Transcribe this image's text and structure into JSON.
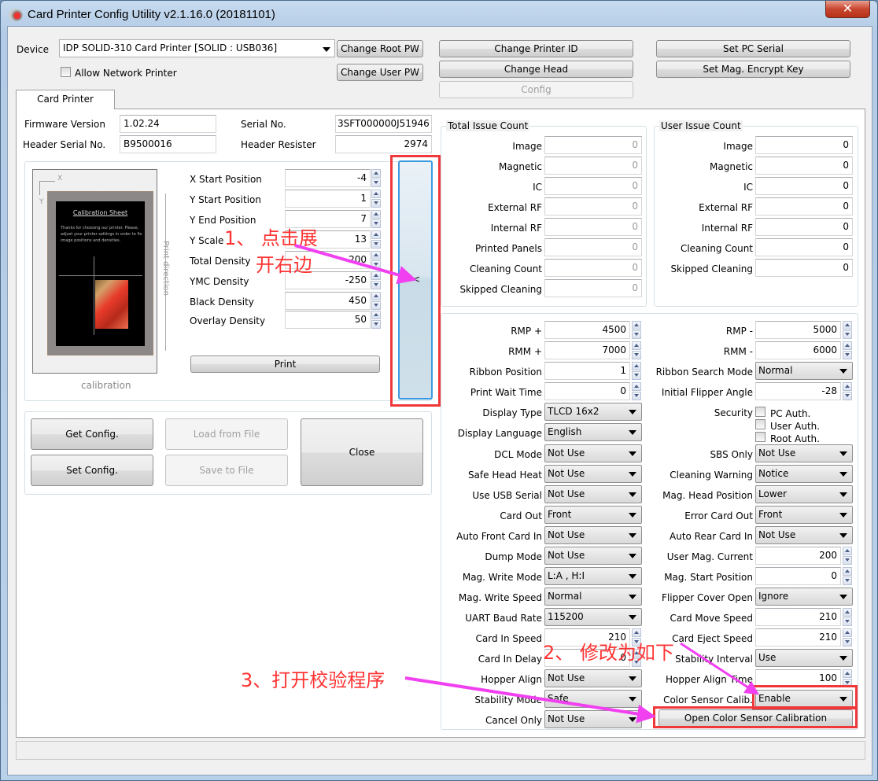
{
  "window": {
    "title": "Card Printer Config Utility v2.1.16.0 (20181101)",
    "close": "✕"
  },
  "device": {
    "label": "Device",
    "value": "IDP SOLID-310 Card Printer  [SOLID : USB036]",
    "allow_network": "Allow Network Printer",
    "allow_network_checked": false
  },
  "buttons": {
    "change_root_pw": "Change Root PW",
    "change_user_pw": "Change User PW",
    "change_printer_id": "Change Printer ID",
    "change_head": "Change Head",
    "config": "Config",
    "set_pc_serial": "Set PC Serial",
    "set_mag_key": "Set Mag. Encrypt Key",
    "print": "Print",
    "get_config": "Get Config.",
    "set_config": "Set Config.",
    "load_file": "Load from File",
    "save_file": "Save to File",
    "close": "Close",
    "open_color_calib": "Open Color Sensor Calibration",
    "expand": "<"
  },
  "tab": {
    "label": "Card Printer"
  },
  "info": {
    "firmware_label": "Firmware Version",
    "firmware": "1.02.24",
    "header_serial_label": "Header Serial No.",
    "header_serial": "B9500016",
    "serial_label": "Serial No.",
    "serial": "3SFT000000J51946",
    "resister_label": "Header Resister",
    "resister": "2974"
  },
  "calibration": {
    "caption": "calibration",
    "sheet_title": "Calibration Sheet",
    "sheet_text": "Thanks for choosing our printer. Please, adjust your printer settings in order to fix image positions and densities.",
    "print_direction": "Print direction",
    "x": "X",
    "y": "Y",
    "fields": [
      {
        "label": "X Start Position",
        "value": "-4"
      },
      {
        "label": "Y Start Position",
        "value": "1"
      },
      {
        "label": "Y End Position",
        "value": "7"
      },
      {
        "label": "Y Scale",
        "value": "13"
      },
      {
        "label": "Total Density",
        "value": "200"
      },
      {
        "label": "YMC Density",
        "value": "-250"
      },
      {
        "label": "Black Density",
        "value": "450"
      },
      {
        "label": "Overlay Density",
        "value": "50"
      }
    ]
  },
  "total_issue": {
    "title": "Total Issue Count",
    "rows": [
      {
        "label": "Image",
        "value": "0"
      },
      {
        "label": "Magnetic",
        "value": "0"
      },
      {
        "label": "IC",
        "value": "0"
      },
      {
        "label": "External RF",
        "value": "0"
      },
      {
        "label": "Internal RF",
        "value": "0"
      },
      {
        "label": "Printed Panels",
        "value": "0"
      },
      {
        "label": "Cleaning Count",
        "value": "0"
      },
      {
        "label": "Skipped Cleaning",
        "value": "0"
      }
    ]
  },
  "user_issue": {
    "title": "User Issue Count",
    "rows": [
      {
        "label": "Image",
        "value": "0"
      },
      {
        "label": "Magnetic",
        "value": "0"
      },
      {
        "label": "IC",
        "value": "0"
      },
      {
        "label": "External RF",
        "value": "0"
      },
      {
        "label": "Internal RF",
        "value": "0"
      },
      {
        "label": "Cleaning Count",
        "value": "0"
      },
      {
        "label": "Skipped Cleaning",
        "value": "0"
      }
    ]
  },
  "settings": {
    "left": [
      {
        "label": "RMP +",
        "type": "spin",
        "value": "4500"
      },
      {
        "label": "RMM +",
        "type": "spin",
        "value": "7000"
      },
      {
        "label": "Ribbon Position",
        "type": "spin",
        "value": "1"
      },
      {
        "label": "Print Wait Time",
        "type": "spin",
        "value": "0"
      },
      {
        "label": "Display Type",
        "type": "combo",
        "value": "TLCD 16x2"
      },
      {
        "label": "Display Language",
        "type": "combo",
        "value": "English"
      },
      {
        "label": "DCL Mode",
        "type": "combo",
        "value": "Not Use"
      },
      {
        "label": "Safe Head Heat",
        "type": "combo",
        "value": "Not Use"
      },
      {
        "label": "Use USB Serial",
        "type": "combo",
        "value": "Not Use"
      },
      {
        "label": "Card Out",
        "type": "combo",
        "value": "Front"
      },
      {
        "label": "Auto Front Card In",
        "type": "combo",
        "value": "Not Use"
      },
      {
        "label": "Dump Mode",
        "type": "combo",
        "value": "Not Use"
      },
      {
        "label": "Mag. Write Mode",
        "type": "combo",
        "value": "L:A , H:I"
      },
      {
        "label": "Mag. Write Speed",
        "type": "combo",
        "value": "Normal"
      },
      {
        "label": "UART Baud Rate",
        "type": "combo",
        "value": "115200"
      },
      {
        "label": "Card In Speed",
        "type": "spin",
        "value": "210"
      },
      {
        "label": "Card In Delay",
        "type": "spin",
        "value": "0"
      },
      {
        "label": "Hopper Align",
        "type": "combo",
        "value": "Not Use"
      },
      {
        "label": "Stability Mode",
        "type": "combo",
        "value": "Safe"
      },
      {
        "label": "Cancel Only",
        "type": "combo",
        "value": "Not Use"
      }
    ],
    "right": [
      {
        "label": "RMP -",
        "type": "spin",
        "value": "5000"
      },
      {
        "label": "RMM -",
        "type": "spin",
        "value": "6000"
      },
      {
        "label": "Ribbon Search Mode",
        "type": "combo",
        "value": "Normal"
      },
      {
        "label": "Initial Flipper Angle",
        "type": "spin",
        "value": "-28"
      },
      {
        "label": "Security",
        "type": "check",
        "options": [
          {
            "label": "PC Auth.",
            "checked": false
          },
          {
            "label": "User Auth.",
            "checked": false
          },
          {
            "label": "Root Auth.",
            "checked": false
          }
        ]
      },
      null,
      {
        "label": "SBS Only",
        "type": "combo",
        "value": "Not Use"
      },
      {
        "label": "Cleaning Warning",
        "type": "combo",
        "value": "Notice"
      },
      {
        "label": "Mag. Head Position",
        "type": "combo",
        "value": "Lower"
      },
      {
        "label": "Error Card Out",
        "type": "combo",
        "value": "Front"
      },
      {
        "label": "Auto Rear Card In",
        "type": "combo",
        "value": "Not Use"
      },
      {
        "label": "User Mag. Current",
        "type": "spin",
        "value": "200"
      },
      {
        "label": "Mag. Start Position",
        "type": "spin",
        "value": "0"
      },
      {
        "label": "Flipper Cover Open",
        "type": "combo",
        "value": "Ignore"
      },
      {
        "label": "Card Move Speed",
        "type": "spin",
        "value": "210"
      },
      {
        "label": "Card Eject Speed",
        "type": "spin",
        "value": "210"
      },
      {
        "label": "Stability Interval",
        "type": "combo",
        "value": "Use"
      },
      {
        "label": "Hopper Align Time",
        "type": "spin",
        "value": "100"
      },
      {
        "label": "Color Sensor Calib.",
        "type": "combo",
        "value": "Enable"
      }
    ]
  },
  "annotations": {
    "step1_line1": "1、 点击展",
    "step1_line2": "开右边",
    "step2": "2、 修改为如下",
    "step3": "3、打开校验程序",
    "color": "#ff3333",
    "arrow_color": "#f040f0"
  }
}
